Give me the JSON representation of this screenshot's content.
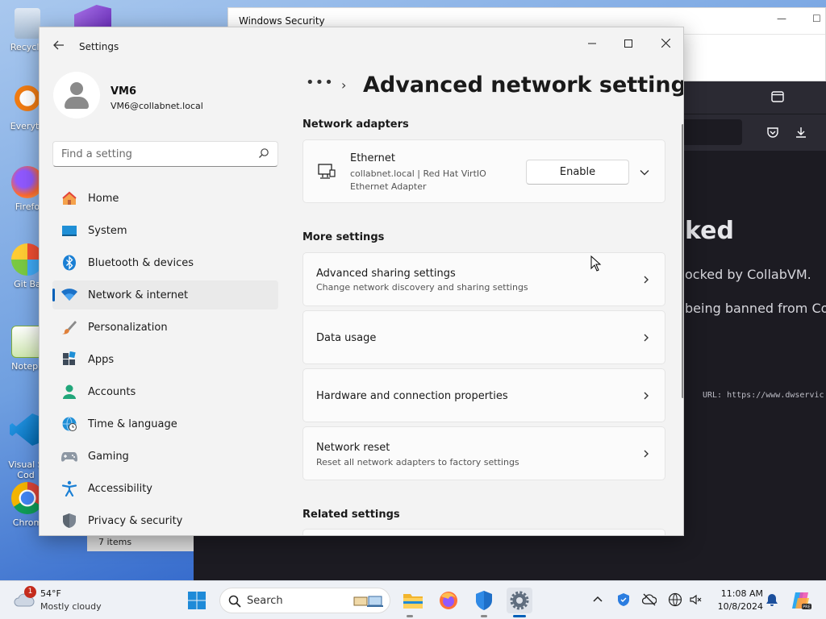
{
  "desktop": {
    "icons": [
      {
        "label": "Recycle"
      },
      {
        "label": "Everyth"
      },
      {
        "label": "Firefo"
      },
      {
        "label": "Git Ba"
      },
      {
        "label": "Notepa"
      },
      {
        "label": "Visual S\nCod"
      },
      {
        "label": "Chrom"
      }
    ]
  },
  "background_windows": {
    "windows_security": {
      "title": "Windows Security"
    },
    "browser": {
      "heading": "ked",
      "line1": "ocked by CollabVM.",
      "line2": "being banned from Collab",
      "url_line": "URL: https://www.dwservic"
    },
    "explorer": {
      "status": "7 items"
    }
  },
  "settings": {
    "app_title": "Settings",
    "profile": {
      "name": "VM6",
      "email": "VM6@collabnet.local"
    },
    "search": {
      "placeholder": "Find a setting"
    },
    "nav": [
      {
        "label": "Home",
        "icon": "home-icon"
      },
      {
        "label": "System",
        "icon": "system-icon"
      },
      {
        "label": "Bluetooth & devices",
        "icon": "bluetooth-icon"
      },
      {
        "label": "Network & internet",
        "icon": "wifi-icon",
        "active": true
      },
      {
        "label": "Personalization",
        "icon": "brush-icon"
      },
      {
        "label": "Apps",
        "icon": "apps-icon"
      },
      {
        "label": "Accounts",
        "icon": "accounts-icon"
      },
      {
        "label": "Time & language",
        "icon": "globe-clock-icon"
      },
      {
        "label": "Gaming",
        "icon": "gamepad-icon"
      },
      {
        "label": "Accessibility",
        "icon": "accessibility-icon"
      },
      {
        "label": "Privacy & security",
        "icon": "shield-icon"
      }
    ],
    "breadcrumb": {
      "dots": "•••",
      "separator": "›"
    },
    "page_title": "Advanced network settings",
    "sections": {
      "network_adapters": "Network adapters",
      "more_settings": "More settings",
      "related_settings": "Related settings"
    },
    "adapter": {
      "name": "Ethernet",
      "desc_line1": "collabnet.local | Red Hat VirtIO",
      "desc_line2": "Ethernet Adapter",
      "enable_label": "Enable"
    },
    "more_items": [
      {
        "title": "Advanced sharing settings",
        "subtitle": "Change network discovery and sharing settings"
      },
      {
        "title": "Data usage",
        "subtitle": ""
      },
      {
        "title": "Hardware and connection properties",
        "subtitle": ""
      },
      {
        "title": "Network reset",
        "subtitle": "Reset all network adapters to factory settings"
      }
    ]
  },
  "taskbar": {
    "weather": {
      "badge": "1",
      "temp": "54°F",
      "condition": "Mostly cloudy"
    },
    "search_label": "Search",
    "clock": {
      "time": "11:08 AM",
      "date": "10/8/2024"
    }
  },
  "colors": {
    "accent": "#005fb8",
    "window_bg": "#f3f3f3",
    "card_bg": "#fbfbfb"
  }
}
